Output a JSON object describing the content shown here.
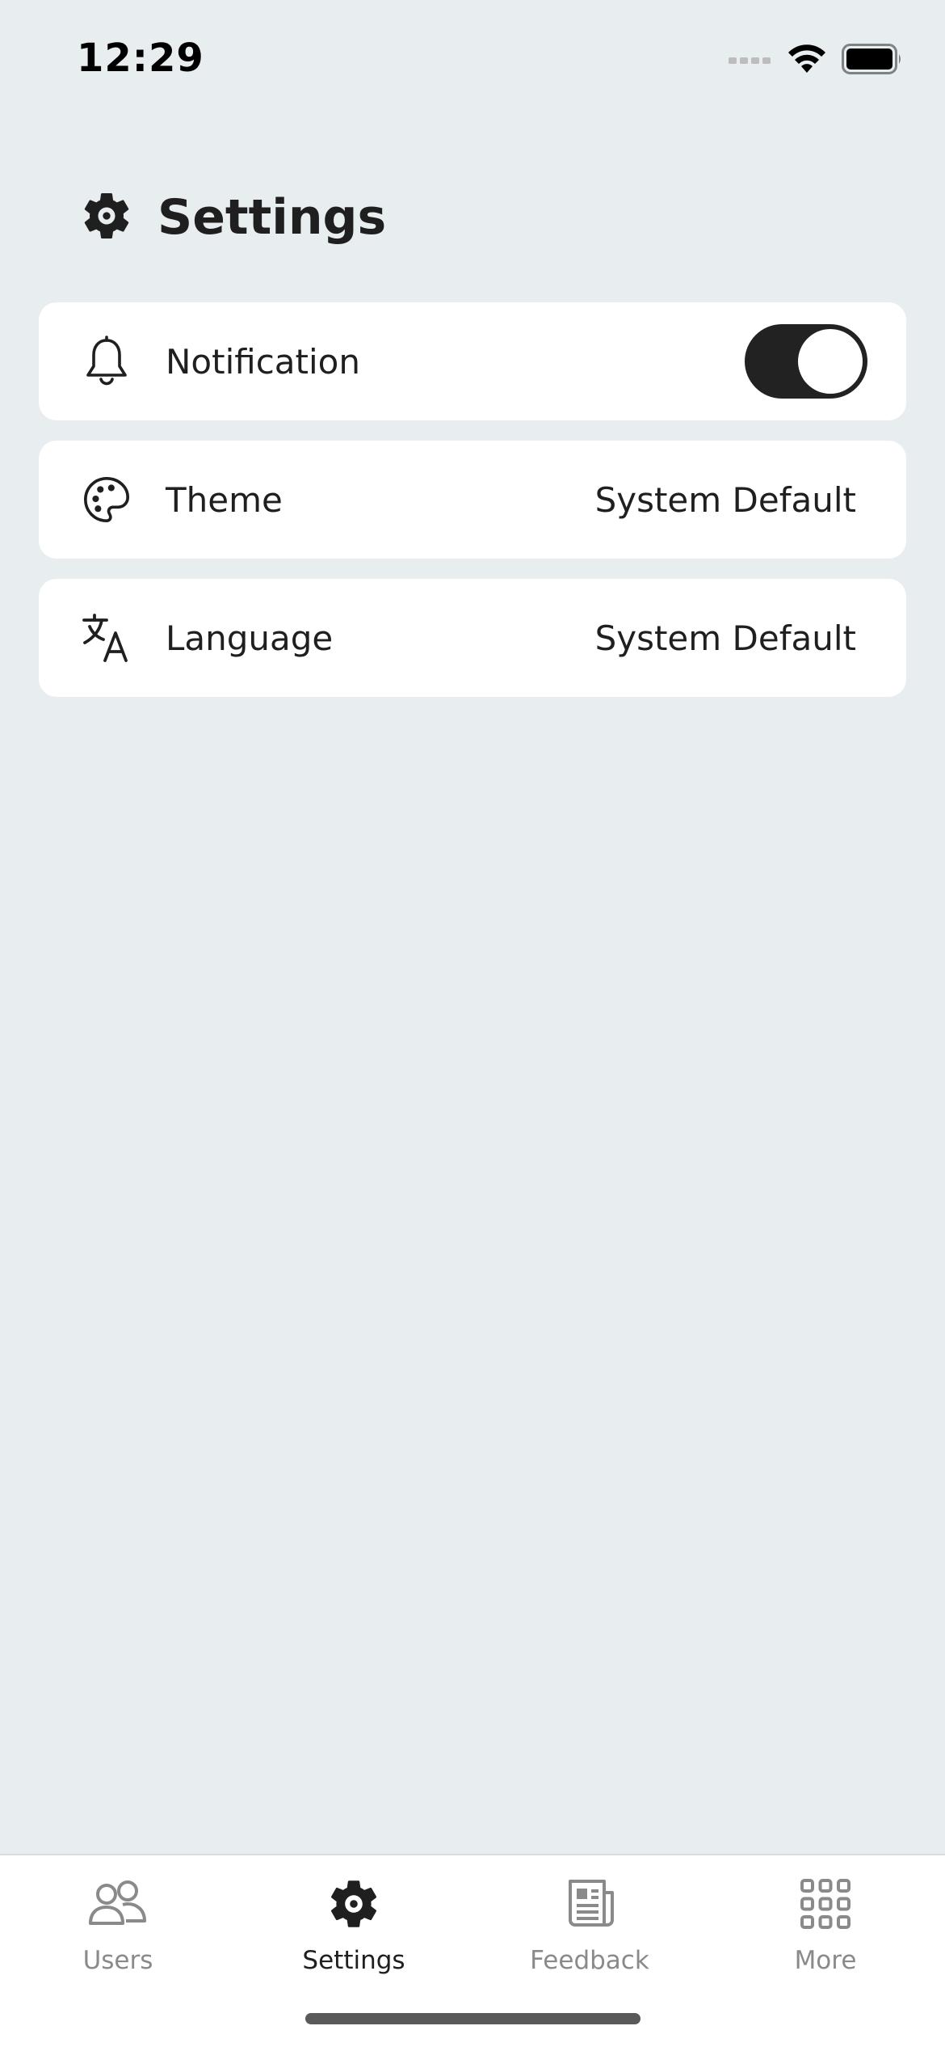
{
  "status_bar": {
    "time": "12:29",
    "icons": [
      "signal-icon",
      "wifi-icon",
      "battery-icon"
    ]
  },
  "header": {
    "icon": "gear-icon",
    "title": "Settings"
  },
  "settings": [
    {
      "icon": "bell-icon",
      "label": "Notification",
      "toggle_on": true
    },
    {
      "icon": "palette-icon",
      "label": "Theme",
      "value": "System Default"
    },
    {
      "icon": "translate-icon",
      "label": "Language",
      "value": "System Default"
    }
  ],
  "tabs": [
    {
      "icon": "users-icon",
      "label": "Users",
      "active": false
    },
    {
      "icon": "gear-icon",
      "label": "Settings",
      "active": true
    },
    {
      "icon": "newspaper-icon",
      "label": "Feedback",
      "active": false
    },
    {
      "icon": "grid-icon",
      "label": "More",
      "active": false
    }
  ],
  "colors": {
    "background": "#e8edf0",
    "card": "#ffffff",
    "text": "#1f1f1f",
    "inactive_tab": "#8a8a8a",
    "toggle_on": "#222222"
  }
}
